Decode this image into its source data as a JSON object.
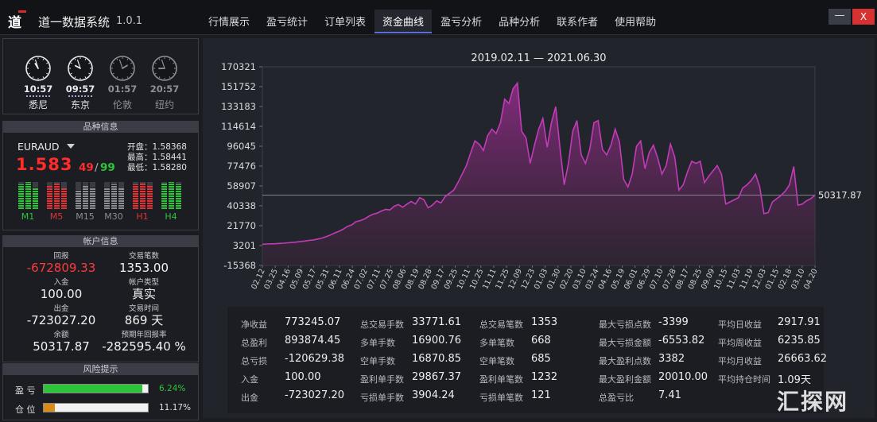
{
  "app": {
    "logo_glyph": "道",
    "title": "道一数据系统",
    "version": "1.0.1"
  },
  "nav": {
    "tabs": [
      {
        "label": "行情展示",
        "active": false
      },
      {
        "label": "盈亏统计",
        "active": false
      },
      {
        "label": "订单列表",
        "active": false
      },
      {
        "label": "资金曲线",
        "active": true
      },
      {
        "label": "盈亏分析",
        "active": false
      },
      {
        "label": "品种分析",
        "active": false
      },
      {
        "label": "联系作者",
        "active": false
      },
      {
        "label": "使用帮助",
        "active": false
      }
    ]
  },
  "window": {
    "minimize": "—",
    "close": "X"
  },
  "clocks": [
    {
      "time": "10:57",
      "city": "悉尼",
      "active": true,
      "hour": 10,
      "minute": 57
    },
    {
      "time": "09:57",
      "city": "东京",
      "active": true,
      "hour": 9,
      "minute": 57
    },
    {
      "time": "01:57",
      "city": "伦敦",
      "active": false,
      "hour": 1,
      "minute": 57
    },
    {
      "time": "20:57",
      "city": "纽约",
      "active": false,
      "hour": 20,
      "minute": 57
    }
  ],
  "product": {
    "header": "品种信息",
    "symbol": "EURAUD",
    "price_main": "1.583",
    "price_small": "49",
    "price_sep": "/",
    "price_spread": "99",
    "open": "开盘：1.58368",
    "high": "最高：1.58441",
    "low": "最低：1.58280",
    "timeframes": [
      {
        "label": "M1",
        "color": "#2ec43a",
        "levels": [
          0.9,
          1.0,
          0.8
        ]
      },
      {
        "label": "M5",
        "color": "#e03434",
        "levels": [
          0.85,
          0.95,
          0.75
        ]
      },
      {
        "label": "M15",
        "color": "#8a8d94",
        "levels": [
          0.7,
          0.85,
          0.8
        ]
      },
      {
        "label": "M30",
        "color": "#8a8d94",
        "levels": [
          0.8,
          0.9,
          0.75
        ]
      },
      {
        "label": "H1",
        "color": "#e03434",
        "levels": [
          0.9,
          0.95,
          0.85
        ]
      },
      {
        "label": "H4",
        "color": "#2ec43a",
        "levels": [
          0.95,
          1.0,
          0.9
        ]
      }
    ]
  },
  "account": {
    "header": "帐户信息",
    "cells": [
      {
        "label": "回报",
        "value": "-672809.33",
        "red": true
      },
      {
        "label": "交易笔数",
        "value": "1353.00",
        "red": false
      },
      {
        "label": "入金",
        "value": "100.00",
        "red": false
      },
      {
        "label": "帐户类型",
        "value": "真实",
        "red": false
      },
      {
        "label": "出金",
        "value": "-723027.20",
        "red": false
      },
      {
        "label": "交易时间",
        "value": "869 天",
        "red": false
      },
      {
        "label": "余额",
        "value": "50317.87",
        "red": false
      },
      {
        "label": "预期年回报率",
        "value": "-282595.40 %",
        "red": false
      }
    ]
  },
  "risk": {
    "header": "风险提示",
    "profit_label": "盈  亏",
    "profit_value": "6.24%",
    "profit_fraction": 0.95,
    "position_label": "仓  位",
    "position_value": "11.17%",
    "position_fraction": 0.11
  },
  "chart_data": {
    "type": "area",
    "title": "2019.02.11 — 2021.06.30",
    "ylim": [
      -15368,
      170321
    ],
    "yticks": [
      "170321",
      "151752",
      "133183",
      "114614",
      "96045",
      "77476",
      "58907",
      "40338",
      "21770",
      "3201",
      "-15368"
    ],
    "x_ticks": [
      "02.12",
      "03.25",
      "04.16",
      "05.09",
      "05.17",
      "05.31",
      "06.11",
      "06.24",
      "07.02",
      "07.11",
      "07.25",
      "08.06",
      "08.19",
      "08.28",
      "09.17",
      "09.25",
      "10.11",
      "10.25",
      "11.11",
      "11.25",
      "12.09",
      "12.23",
      "01.03",
      "01.30",
      "02.20",
      "03.10",
      "03.24",
      "04.16",
      "05.19",
      "06.01",
      "06.29",
      "07.10",
      "07.28",
      "08.17",
      "08.25",
      "09.09",
      "10.15",
      "11.03",
      "11.19",
      "12.03",
      "01.15",
      "02.18",
      "03.10",
      "04.20"
    ],
    "last_value_label": "50317.87",
    "last_value": 50317.87,
    "values": [
      4500,
      4700,
      4800,
      4900,
      5200,
      5400,
      5800,
      6100,
      6500,
      7000,
      7400,
      8000,
      8500,
      9300,
      10200,
      11500,
      13000,
      15000,
      16500,
      18500,
      21000,
      22500,
      25500,
      26500,
      28000,
      30500,
      32500,
      33500,
      35500,
      37000,
      36500,
      40000,
      41500,
      39000,
      42000,
      44500,
      42000,
      48000,
      46000,
      38500,
      41000,
      45000,
      43000,
      49000,
      52000,
      55000,
      62000,
      70000,
      78000,
      90000,
      101000,
      98000,
      92000,
      106000,
      112000,
      108000,
      118000,
      140000,
      136000,
      150000,
      155000,
      110000,
      104000,
      80000,
      97000,
      112000,
      122000,
      95000,
      118000,
      133000,
      95000,
      60000,
      80000,
      110000,
      120000,
      88000,
      80000,
      93000,
      118000,
      120000,
      93000,
      88000,
      97000,
      112000,
      100000,
      65000,
      58000,
      70000,
      96000,
      101000,
      75000,
      90000,
      97000,
      85000,
      70000,
      78000,
      98000,
      86000,
      55000,
      60000,
      72000,
      82000,
      80000,
      82000,
      62000,
      68000,
      73000,
      78000,
      70000,
      42000,
      44000,
      46000,
      48000,
      57000,
      60000,
      64000,
      70000,
      58000,
      33000,
      34000,
      44000,
      47000,
      50000,
      54000,
      60000,
      77000,
      41000,
      42000,
      45000,
      47000,
      50317.87
    ]
  },
  "stats": {
    "columns": [
      [
        {
          "label": "净收益",
          "value": "773245.07"
        },
        {
          "label": "总盈利",
          "value": "893874.45"
        },
        {
          "label": "总亏损",
          "value": "-120629.38"
        },
        {
          "label": "入金",
          "value": "100.00"
        },
        {
          "label": "出金",
          "value": "-723027.20"
        }
      ],
      [
        {
          "label": "总交易手数",
          "value": "33771.61"
        },
        {
          "label": "多单手数",
          "value": "16900.76"
        },
        {
          "label": "空单手数",
          "value": "16870.85"
        },
        {
          "label": "盈利单手数",
          "value": "29867.37"
        },
        {
          "label": "亏损单手数",
          "value": "3904.24"
        }
      ],
      [
        {
          "label": "总交易笔数",
          "value": "1353"
        },
        {
          "label": "多单笔数",
          "value": "668"
        },
        {
          "label": "空单笔数",
          "value": "685"
        },
        {
          "label": "盈利单笔数",
          "value": "1232"
        },
        {
          "label": "亏损单笔数",
          "value": "121"
        }
      ],
      [
        {
          "label": "最大亏损点数",
          "value": "-3399"
        },
        {
          "label": "最大亏损金额",
          "value": "-6553.82"
        },
        {
          "label": "最大盈利点数",
          "value": "3382"
        },
        {
          "label": "最大盈利金额",
          "value": "20010.00"
        },
        {
          "label": "总盈亏比",
          "value": "7.41"
        }
      ],
      [
        {
          "label": "平均日收益",
          "value": "2917.91"
        },
        {
          "label": "平均周收益",
          "value": "6235.85"
        },
        {
          "label": "平均月收益",
          "value": "26663.62"
        },
        {
          "label": "平均持仓时间",
          "value": "1.09天"
        }
      ]
    ]
  },
  "watermark": "汇探网"
}
